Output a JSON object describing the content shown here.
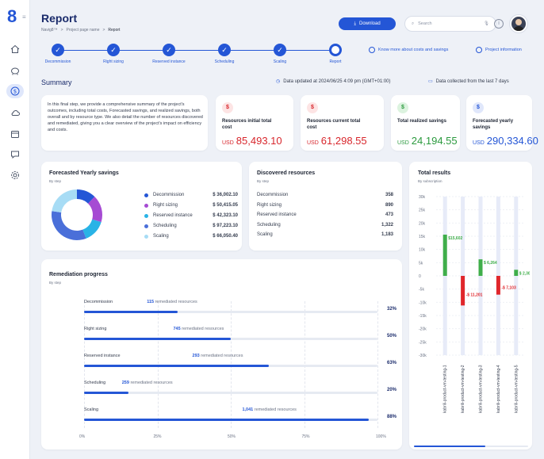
{
  "brand": {
    "logo": "8",
    "menu": "≡"
  },
  "header": {
    "title": "Report",
    "breadcrumbs": [
      "Navig8™",
      ">",
      "Project page name",
      ">",
      "Report"
    ],
    "download_label": "Download",
    "search_placeholder": "Search"
  },
  "steps": [
    "Decommission",
    "Right sizing",
    "Reserved instance",
    "Scheduling",
    "Scaling",
    "Report"
  ],
  "links": {
    "costs": "Know more about costs and savings",
    "project": "Project information"
  },
  "summary": {
    "title": "Summary",
    "updated": "Data updated at 2024/06/25 4:09 pm (GMT+01:00)",
    "collected": "Data collected from the last 7 days",
    "description": "In this final step, we provide a comprehensive summary of the project's outcomes, including total costs, Forecasted savings, and realized savings, both overall and by resource type. We also detail the number of resources discovered and remediated, giving you a clear overview of the project's impact on efficiency and costs."
  },
  "kpis": [
    {
      "label": "Resources initial total cost",
      "currency": "USD",
      "value": "85,493.10",
      "icon": "$",
      "color": "#d8262c",
      "bg": "#fde4e4"
    },
    {
      "label": "Resources current total cost",
      "currency": "USD",
      "value": "61,298.55",
      "icon": "$",
      "color": "#d8262c",
      "bg": "#fde4e4"
    },
    {
      "label": "Total realized savings",
      "currency": "USD",
      "value": "24,194.55",
      "icon": "$",
      "color": "#2b9a3e",
      "bg": "#dcf3df"
    },
    {
      "label": "Forecasted yearly savings",
      "currency": "USD",
      "value": "290,334.60",
      "icon": "$",
      "color": "#2456d6",
      "bg": "#e0e7fb"
    }
  ],
  "forecast": {
    "title": "Forecasted Yearly savings",
    "subtitle": "By step",
    "items": [
      {
        "label": "Decommission",
        "value": "$ 36,002.10",
        "amount": 36002.1,
        "color": "#2456d6"
      },
      {
        "label": "Right sizing",
        "value": "$ 50,415.05",
        "amount": 50415.05,
        "color": "#a64bd3"
      },
      {
        "label": "Reserved instance",
        "value": "$ 42,323.10",
        "amount": 42323.1,
        "color": "#29b3e6"
      },
      {
        "label": "Scheduling",
        "value": "$ 97,223.10",
        "amount": 97223.1,
        "color": "#4a6fd9"
      },
      {
        "label": "Scaling",
        "value": "$ 66,050.40",
        "amount": 66050.4,
        "color": "#a7dcf5"
      }
    ]
  },
  "discovered": {
    "title": "Discovered resources",
    "subtitle": "By step",
    "items": [
      {
        "label": "Decommission",
        "value": "358"
      },
      {
        "label": "Right sizing",
        "value": "890"
      },
      {
        "label": "Reserved instance",
        "value": "473"
      },
      {
        "label": "Scheduling",
        "value": "1,322"
      },
      {
        "label": "Scaling",
        "value": "1,183"
      }
    ]
  },
  "remediation": {
    "title": "Remediation progress",
    "subtitle": "By step",
    "suffix": "remediated resources",
    "items": [
      {
        "label": "Decommission",
        "count": "115",
        "pct": "32%",
        "frac": 0.32
      },
      {
        "label": "Right sizing",
        "count": "745",
        "pct": "50%",
        "frac": 0.5
      },
      {
        "label": "Reserved instance",
        "count": "293",
        "pct": "63%",
        "frac": 0.63
      },
      {
        "label": "Scheduling",
        "count": "259",
        "pct": "20%",
        "frac": 0.15
      },
      {
        "label": "Scaling",
        "count": "1,041",
        "pct": "88%",
        "frac": 0.97
      }
    ],
    "ticks": [
      "0%",
      "25%",
      "50%",
      "75%",
      "100%"
    ]
  },
  "chart_data": {
    "type": "bar",
    "title": "Total results",
    "subtitle": "By subscription",
    "categories": [
      "kabrili-product-vm-testing-1",
      "kabrili-product-vm-testing-2",
      "kabrili-product-vm-testing-3",
      "kabrili-product-vm-testing-4",
      "kabrili-product-vm-testing-5"
    ],
    "series": [
      {
        "name": "",
        "values": [
          15602,
          -11201,
          6264,
          -7103,
          2304
        ],
        "labels": [
          "$15,602",
          "-$ 11,201",
          "$ 6,264",
          "-$ 7,103",
          "$ 2,304"
        ]
      }
    ],
    "ylim": [
      -30000,
      30000
    ],
    "yticks": [
      "30k",
      "25k",
      "20k",
      "15k",
      "10k",
      "5k",
      "0",
      "-5k",
      "-10k",
      "-15k",
      "-20k",
      "-25k",
      "-30k"
    ],
    "yvalues": [
      30000,
      25000,
      20000,
      15000,
      10000,
      5000,
      0,
      -5000,
      -10000,
      -15000,
      -20000,
      -25000,
      -30000
    ],
    "positive_color": "#3fae4a",
    "negative_color": "#e0262b",
    "grid": true
  }
}
